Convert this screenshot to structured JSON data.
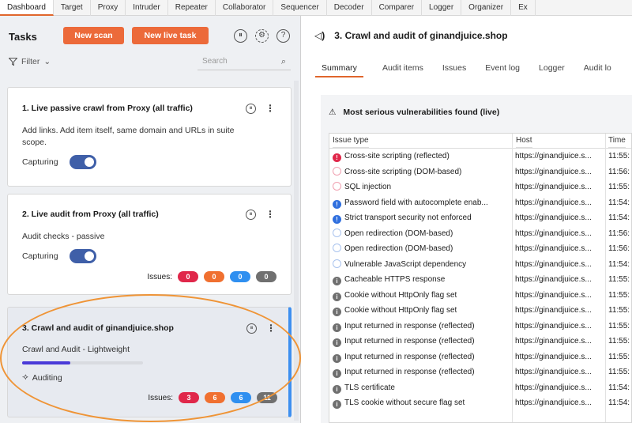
{
  "top_tabs": [
    "Dashboard",
    "Target",
    "Proxy",
    "Intruder",
    "Repeater",
    "Collaborator",
    "Sequencer",
    "Decoder",
    "Comparer",
    "Logger",
    "Organizer",
    "Ex"
  ],
  "tasks": {
    "title": "Tasks",
    "new_scan_label": "New scan",
    "new_live_task_label": "New live task",
    "filter_label": "Filter",
    "search_placeholder": "Search"
  },
  "cards": [
    {
      "title": "1. Live passive crawl from Proxy (all traffic)",
      "description_line1": "Add links. Add item itself, same domain and URLs in suite",
      "description_line2": "scope.",
      "capture_label": "Capturing"
    },
    {
      "title": "2. Live audit from Proxy (all traffic)",
      "description": "Audit checks - passive",
      "capture_label": "Capturing",
      "issues_label": "Issues:",
      "issues": [
        "0",
        "0",
        "0",
        "0"
      ]
    },
    {
      "title": "3. Crawl and audit of ginandjuice.shop",
      "description": "Crawl and Audit - Lightweight",
      "progress": 0.4,
      "status": "Auditing",
      "issues_label": "Issues:",
      "issues": [
        "3",
        "6",
        "6",
        "11"
      ]
    }
  ],
  "issue_colors": [
    "#e0274a",
    "#f07030",
    "#2f8ff0",
    "#707070"
  ],
  "detail": {
    "title": "3. Crawl and audit of ginandjuice.shop",
    "subtabs": [
      "Summary",
      "Audit items",
      "Issues",
      "Event log",
      "Logger",
      "Audit lo"
    ],
    "section_title": "Most serious vulnerabilities found (live)",
    "columns": [
      "Issue type",
      "Host",
      "Time"
    ],
    "rows": [
      {
        "severity": "high",
        "issue": "Cross-site scripting (reflected)",
        "host": "https://ginandjuice.s...",
        "time": "11:55:"
      },
      {
        "severity": "high-tent",
        "issue": "Cross-site scripting (DOM-based)",
        "host": "https://ginandjuice.s...",
        "time": "11:56:"
      },
      {
        "severity": "high-tent",
        "issue": "SQL injection",
        "host": "https://ginandjuice.s...",
        "time": "11:55:"
      },
      {
        "severity": "med",
        "issue": "Password field with autocomplete enab...",
        "host": "https://ginandjuice.s...",
        "time": "11:54:"
      },
      {
        "severity": "med",
        "issue": "Strict transport security not enforced",
        "host": "https://ginandjuice.s...",
        "time": "11:54:"
      },
      {
        "severity": "low-tent",
        "issue": "Open redirection (DOM-based)",
        "host": "https://ginandjuice.s...",
        "time": "11:56:"
      },
      {
        "severity": "low-tent",
        "issue": "Open redirection (DOM-based)",
        "host": "https://ginandjuice.s...",
        "time": "11:56:"
      },
      {
        "severity": "low-tent",
        "issue": "Vulnerable JavaScript dependency",
        "host": "https://ginandjuice.s...",
        "time": "11:54:"
      },
      {
        "severity": "info",
        "issue": "Cacheable HTTPS response",
        "host": "https://ginandjuice.s...",
        "time": "11:55:"
      },
      {
        "severity": "info",
        "issue": "Cookie without HttpOnly flag set",
        "host": "https://ginandjuice.s...",
        "time": "11:55:"
      },
      {
        "severity": "info",
        "issue": "Cookie without HttpOnly flag set",
        "host": "https://ginandjuice.s...",
        "time": "11:55:"
      },
      {
        "severity": "info",
        "issue": "Input returned in response (reflected)",
        "host": "https://ginandjuice.s...",
        "time": "11:55:"
      },
      {
        "severity": "info",
        "issue": "Input returned in response (reflected)",
        "host": "https://ginandjuice.s...",
        "time": "11:55:"
      },
      {
        "severity": "info",
        "issue": "Input returned in response (reflected)",
        "host": "https://ginandjuice.s...",
        "time": "11:55:"
      },
      {
        "severity": "info",
        "issue": "Input returned in response (reflected)",
        "host": "https://ginandjuice.s...",
        "time": "11:55:"
      },
      {
        "severity": "info",
        "issue": "TLS certificate",
        "host": "https://ginandjuice.s...",
        "time": "11:54:"
      },
      {
        "severity": "info",
        "issue": "TLS cookie without secure flag set",
        "host": "https://ginandjuice.s...",
        "time": "11:54:"
      }
    ]
  }
}
